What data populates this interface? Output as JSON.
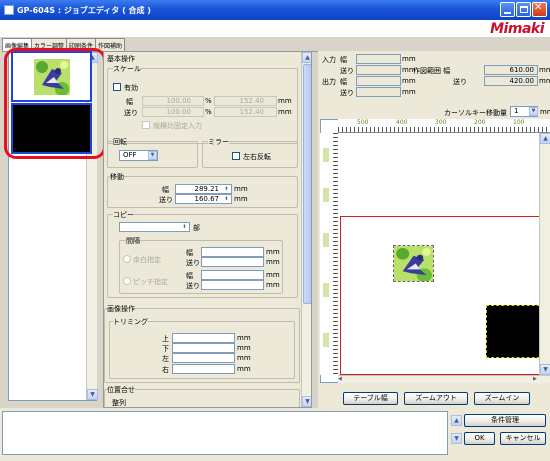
{
  "window": {
    "title": "GP-604S : ジョブエディタ ( 合成 )",
    "brand": "Mimaki"
  },
  "tabs": [
    "画像編集",
    "カラー調整",
    "印刷条件",
    "作図補助"
  ],
  "panel": {
    "basic_ops": "基本操作",
    "scale": {
      "label": "スケール",
      "enable_label": "有効",
      "width_label": "幅",
      "feed_label": "送り",
      "width_pct": "100.00",
      "feed_pct": "100.00",
      "pct_unit": "%",
      "width_mm": "152.40",
      "feed_mm": "152.40",
      "mm_unit": "mm",
      "keep_ratio_label": "縦横比固定入力"
    },
    "rotation": {
      "label": "回転",
      "value": "OFF"
    },
    "mirror": {
      "label": "ミラー",
      "flip_label": "左右反転"
    },
    "move": {
      "label": "移動",
      "width_label": "幅",
      "feed_label": "送り",
      "width": "289.21",
      "feed": "160.67",
      "unit": "mm"
    },
    "copy": {
      "label": "コピー",
      "count_unit": "部",
      "gap_label": "間隔",
      "auto_label": "余白指定",
      "pitch_label": "ピッチ指定",
      "width_label": "幅",
      "feed_label": "送り",
      "unit": "mm"
    },
    "image_ops": "画像操作",
    "trimming": {
      "label": "トリミング",
      "top": "上",
      "bottom": "下",
      "left": "左",
      "right": "右",
      "unit": "mm"
    },
    "align": {
      "label": "位置合せ",
      "arrange_label": "整列"
    }
  },
  "info": {
    "input_label": "入力",
    "output_label": "出力",
    "width_label": "幅",
    "feed_label": "送り",
    "unit": "mm",
    "drawing_width_label": "作図範囲 幅",
    "drawing_feed_label": "送り",
    "drawing_width": "610.00",
    "drawing_feed": "420.00",
    "cursor_label": "カーソルキー移動量",
    "cursor_value": "1"
  },
  "ruler": {
    "top": [
      "500",
      "400",
      "300",
      "200",
      "100"
    ]
  },
  "canvas_buttons": {
    "table_width": "テーブル幅",
    "zoom_out": "ズームアウト",
    "zoom_in": "ズームイン"
  },
  "bottom": {
    "condition_mgmt": "条件管理",
    "ok": "OK",
    "cancel": "キャンセル"
  }
}
